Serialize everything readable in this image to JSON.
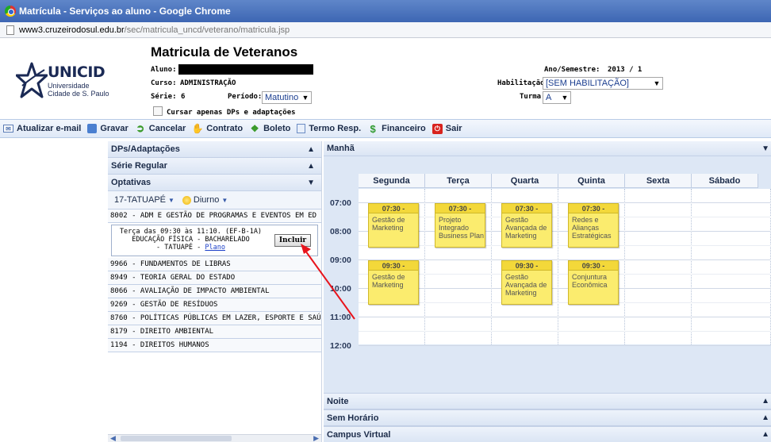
{
  "window": {
    "title": "Matrícula - Serviços ao aluno - Google Chrome",
    "url_host": "www3.cruzeirodosul.edu.br",
    "url_path": "/sec/matricula_uncd/veterano/matricula.jsp"
  },
  "logo": {
    "name": "UNICID",
    "sub1": "Universidade",
    "sub2": "Cidade de S. Paulo"
  },
  "header": {
    "title": "Matricula de Veteranos",
    "aluno_label": "Aluno:",
    "curso_label": "Curso:",
    "curso_value": "ADMINISTRAÇÃO",
    "serie_label": "Série:",
    "serie_value": "6",
    "periodo_label": "Período:",
    "periodo_value": "Matutino",
    "dps_checkbox_label": "Cursar apenas DPs e adaptações",
    "ano_label": "Ano/Semestre:",
    "ano_value": "2013 / 1",
    "habilitacao_label": "Habilitação:",
    "habilitacao_value": "[SEM HABILITAÇÃO]",
    "turma_label": "Turma:",
    "turma_value": "A"
  },
  "toolbar": {
    "atualizar": "Atualizar e-mail",
    "gravar": "Gravar",
    "cancelar": "Cancelar",
    "contrato": "Contrato",
    "boleto": "Boleto",
    "termo": "Termo Resp.",
    "financeiro": "Financeiro",
    "sair": "Sair"
  },
  "left": {
    "sections": [
      "DPs/Adaptações",
      "Série Regular",
      "Optativas"
    ],
    "filter_campus": "17-TATUAPÉ",
    "filter_turno": "Diurno",
    "selected_course": "8002 - ADM E GESTÃO DE PROGRAMAS E EVENTOS EM ED",
    "option_line1": "Terça das 09:30 às 11:10. (EF-B-1A)",
    "option_line2": "EDUCAÇÃO FÍSICA - BACHARELADO",
    "option_line3": "- TATUAPÉ -",
    "option_link": "Plano",
    "incluir": "Incluir",
    "courses": [
      "9966 - FUNDAMENTOS DE LIBRAS",
      "8949 - TEORIA GERAL DO ESTADO",
      "8066 - AVALIAÇÃO DE IMPACTO AMBIENTAL",
      "9269 - GESTÃO DE RESÍDUOS",
      "8760 - POLÍTICAS PÚBLICAS EM LAZER, ESPORTE E SAÚ",
      "8179 - DIREITO AMBIENTAL",
      "1194 - DIREITOS HUMANOS"
    ]
  },
  "schedule": {
    "header": "Manhã",
    "days": [
      "Segunda",
      "Terça",
      "Quarta",
      "Quinta",
      "Sexta",
      "Sábado"
    ],
    "times": [
      "07:00",
      "08:00",
      "09:00",
      "10:00",
      "11:00",
      "12:00"
    ],
    "events": [
      {
        "day": 0,
        "start": "07:30 -",
        "title": "Gestão de Marketing"
      },
      {
        "day": 1,
        "start": "07:30 -",
        "title": "Projeto Integrado Business Plan"
      },
      {
        "day": 2,
        "start": "07:30 -",
        "title": "Gestão Avançada de Marketing"
      },
      {
        "day": 3,
        "start": "07:30 -",
        "title": "Redes e Alianças Estratégicas"
      },
      {
        "day": 0,
        "start": "09:30 -",
        "title": "Gestão de Marketing"
      },
      {
        "day": 2,
        "start": "09:30 -",
        "title": "Gestão Avançada de Marketing"
      },
      {
        "day": 3,
        "start": "09:30 -",
        "title": "Conjuntura Econômica"
      }
    ],
    "bottom_sections": [
      "Noite",
      "Sem Horário",
      "Campus Virtual"
    ]
  },
  "colors": {
    "event_fill": "#fbec6e",
    "event_header": "#f3d83a",
    "annotation_arrow": "#e8141c"
  }
}
